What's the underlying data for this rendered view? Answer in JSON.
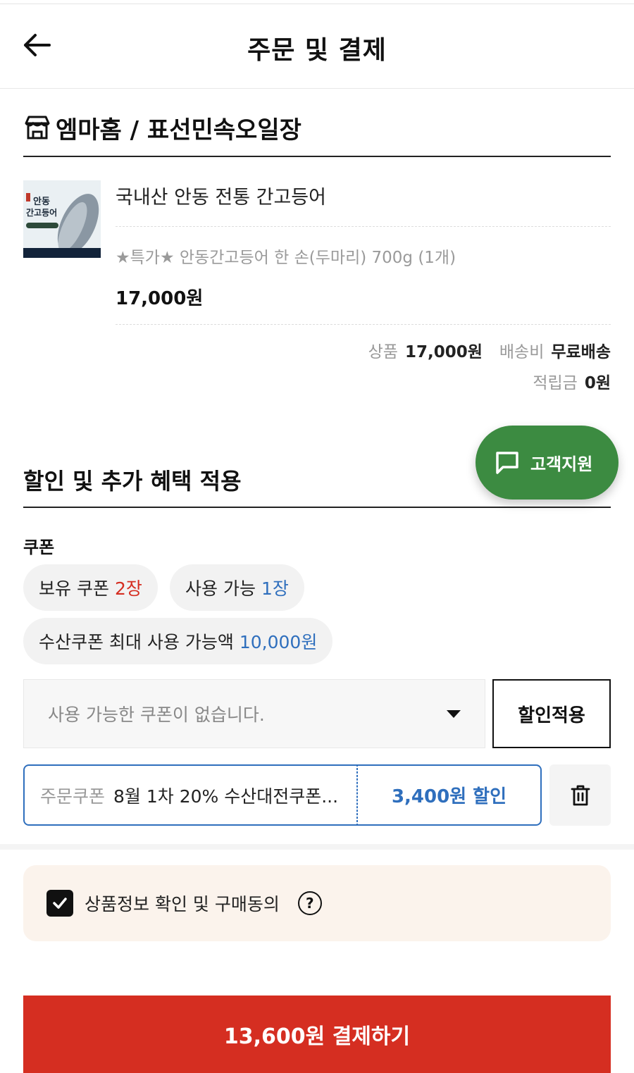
{
  "header": {
    "title": "주문 및 결제"
  },
  "store": {
    "name": "엠마홈 / 표선민속오일장"
  },
  "product": {
    "thumb_line1": "안동",
    "thumb_line2": "간고등어",
    "name": "국내산 안동 전통 간고등어",
    "option": "★특가★ 안동간고등어 한 손(두마리) 700g (1개)",
    "price": "17,000원"
  },
  "summary": {
    "product_label": "상품",
    "product_value": "17,000원",
    "shipping_label": "배송비",
    "shipping_value": "무료배송",
    "points_label": "적립금",
    "points_value": "0원"
  },
  "benefits": {
    "title": "할인 및 추가 혜택 적용"
  },
  "support": {
    "label": "고객지원"
  },
  "coupon": {
    "label": "쿠폰",
    "owned_label": "보유 쿠폰",
    "owned_count": "2장",
    "usable_label": "사용 가능",
    "usable_count": "1장",
    "max_label": "수산쿠폰 최대 사용 가능액",
    "max_value": "10,000원",
    "select_placeholder": "사용 가능한 쿠폰이 없습니다.",
    "apply_label": "할인적용",
    "applied_tag": "주문쿠폰",
    "applied_name": "8월 1차 20% 수산대전쿠폰...",
    "applied_discount": "3,400원 할인"
  },
  "agree": {
    "label": "상품정보 확인 및 구매동의",
    "help": "?"
  },
  "pay": {
    "label": "13,600원 결제하기"
  },
  "colors": {
    "accent_red": "#d52e21",
    "accent_blue": "#2f6fbd",
    "support_green": "#3c8b41"
  }
}
